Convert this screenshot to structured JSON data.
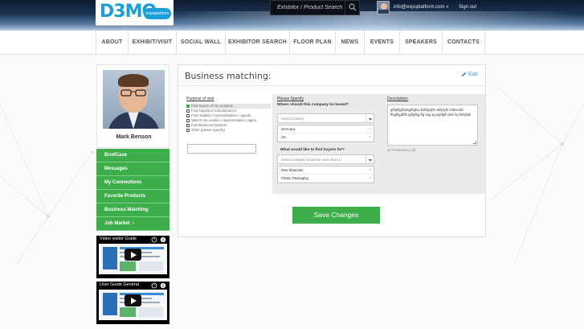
{
  "header": {
    "logo_text": "D3MO",
    "logo_badge": "expoplatform",
    "search_placeholder": "Exhibitor / Product Search",
    "user_email": "info@expoplatform.com »",
    "signout": "Sign out"
  },
  "nav": {
    "items": [
      "ABOUT",
      "EXHIBIT/VISIT",
      "SOCIAL WALL",
      "EXHIBITOR SEARCH",
      "FLOOR PLAN",
      "NEWS",
      "EVENTS",
      "SPEAKERS",
      "CONTACTS"
    ]
  },
  "sidebar": {
    "profile_name": "Mark Benson",
    "menu": [
      "BriefCase",
      "Messages",
      "My Connections",
      "Favorite Products",
      "Business Matching",
      "Job Market"
    ],
    "job_market_chevron": "›",
    "videos": [
      {
        "title": "Video visitor Guide"
      },
      {
        "title": "User Guide General"
      }
    ]
  },
  "panel": {
    "title": "Business matching:",
    "edit_label": "Edit",
    "purpose_heading": "Purpose of visit",
    "purpose_items": [
      "Find buyers of my products",
      "Find suppliers/ manufacturers",
      "Find retailers / representatives / agents",
      "Want to be reseller / representative / agent",
      "Find Business Partners",
      "Other (please specify)"
    ],
    "please_specify": "Please Specify",
    "location_question": "Where should this company be based?",
    "country_placeholder": "Select Country",
    "countries": [
      "Germany",
      "UK"
    ],
    "buyers_question": "What would like to find buyers for?",
    "category_placeholder": "Select Category (could be more than 1)",
    "categories": [
      "Raw Materials",
      "Plastic Packaging"
    ],
    "remove_symbol": "×",
    "description_label": "Description:",
    "description_text": "gfhjdfjgfhjdsgfhjdsv bdhfgdyfv ahfjzyfv chbvcvbc ffsgfhjgfhfb gdfgfsg ffg vsg  sg  sgsfgfh dsh fsj bshjfsdi",
    "chars_left": "44 Characters Left",
    "save_label": "Save Changes"
  }
}
